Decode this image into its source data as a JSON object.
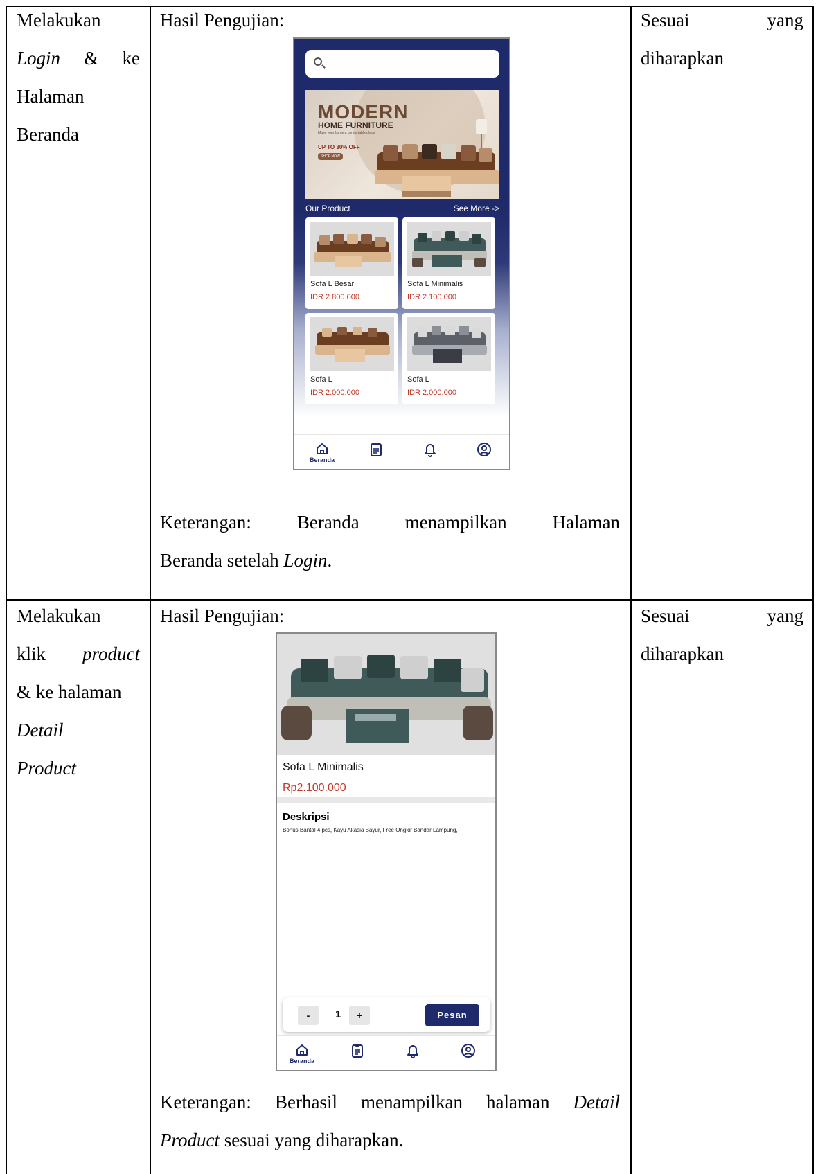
{
  "rows": [
    {
      "action_lines": [
        "Melakukan",
        "Login & ke",
        "Halaman",
        "Beranda"
      ],
      "result_label": "Hasil Pengujian:",
      "expected_lines": [
        "Sesuai yang",
        "diharapkan"
      ],
      "note_line1": "Keterangan: Beranda menampilkan Halaman",
      "note_line2_prefix": "Beranda setelah ",
      "note_line2_italic": "Login",
      "note_line2_suffix": "."
    },
    {
      "action_lines": [
        "Melakukan",
        "klik product",
        "& ke halaman",
        "Detail",
        "Product"
      ],
      "result_label": "Hasil Pengujian:",
      "expected_lines": [
        "Sesuai yang",
        "diharapkan"
      ],
      "note_line1_prefix": "Keterangan: Berhasil menampilkan halaman ",
      "note_line1_italic": "Detail",
      "note_line2_italic": "Product",
      "note_line2_suffix": " sesuai yang diharapkan."
    }
  ],
  "home_screen": {
    "banner": {
      "title": "MODERN",
      "subtitle": "HOME FURNITURE",
      "tagline": "Make your home a comfortable place",
      "promo": "UP TO 30% OFF",
      "cta": "SHOP NOW"
    },
    "section_title": "Our Product",
    "see_more": "See More ->",
    "products": [
      {
        "name": "Sofa L Besar",
        "price": "IDR 2.800.000"
      },
      {
        "name": "Sofa L Minimalis",
        "price": "IDR 2.100.000"
      },
      {
        "name": "Sofa L",
        "price": "IDR 2.000.000"
      },
      {
        "name": "Sofa L",
        "price": "IDR 2.000.000"
      }
    ],
    "nav": {
      "home_label": "Beranda"
    }
  },
  "detail_screen": {
    "name": "Sofa L Minimalis",
    "price": "Rp2.100.000",
    "desc_title": "Deskripsi",
    "desc_text": "Bonus Bantal 4 pcs, Kayu Akasia Bayur, Free Ongkir Bandar Lampung,",
    "minus": "-",
    "qty": "1",
    "plus": "+",
    "order_button": "Pesan",
    "nav": {
      "home_label": "Beranda"
    }
  },
  "colors": {
    "navy": "#1f2a6b",
    "price_red": "#c0392b",
    "sofa_teal": "#3f5a58",
    "sofa_brown": "#6b3e22"
  }
}
